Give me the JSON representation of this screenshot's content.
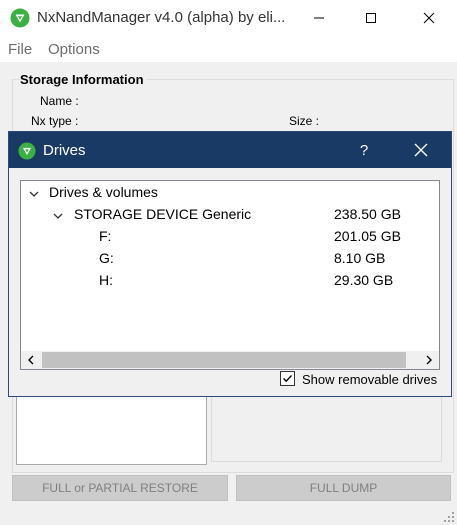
{
  "app": {
    "title": "NxNandManager v4.0 (alpha) by eli..."
  },
  "menu": {
    "file": "File",
    "options": "Options"
  },
  "storage": {
    "title": "Storage Information",
    "name_label": "Name :",
    "nxtype_label": "Nx type :",
    "size_label": "Size :"
  },
  "buttons": {
    "restore": "FULL or PARTIAL RESTORE",
    "dump": "FULL DUMP"
  },
  "dialog": {
    "title": "Drives",
    "help": "?",
    "tree": {
      "root": "Drives & volumes",
      "device": {
        "name": "STORAGE DEVICE Generic",
        "size": "238.50 GB"
      },
      "volumes": [
        {
          "name": "F:",
          "size": "201.05 GB"
        },
        {
          "name": "G:",
          "size": "8.10 GB"
        },
        {
          "name": "H:",
          "size": "29.30 GB"
        }
      ]
    },
    "checkbox_label": "Show removable drives",
    "checkbox_checked": true
  },
  "colors": {
    "dialog_title_bg": "#1a3a66",
    "app_icon_green": "#3cb043",
    "disabled_button": "#cccccc"
  },
  "icons": {
    "app": "green-shield-icon",
    "minimize": "minimize-icon",
    "maximize": "maximize-icon",
    "close": "close-icon"
  }
}
